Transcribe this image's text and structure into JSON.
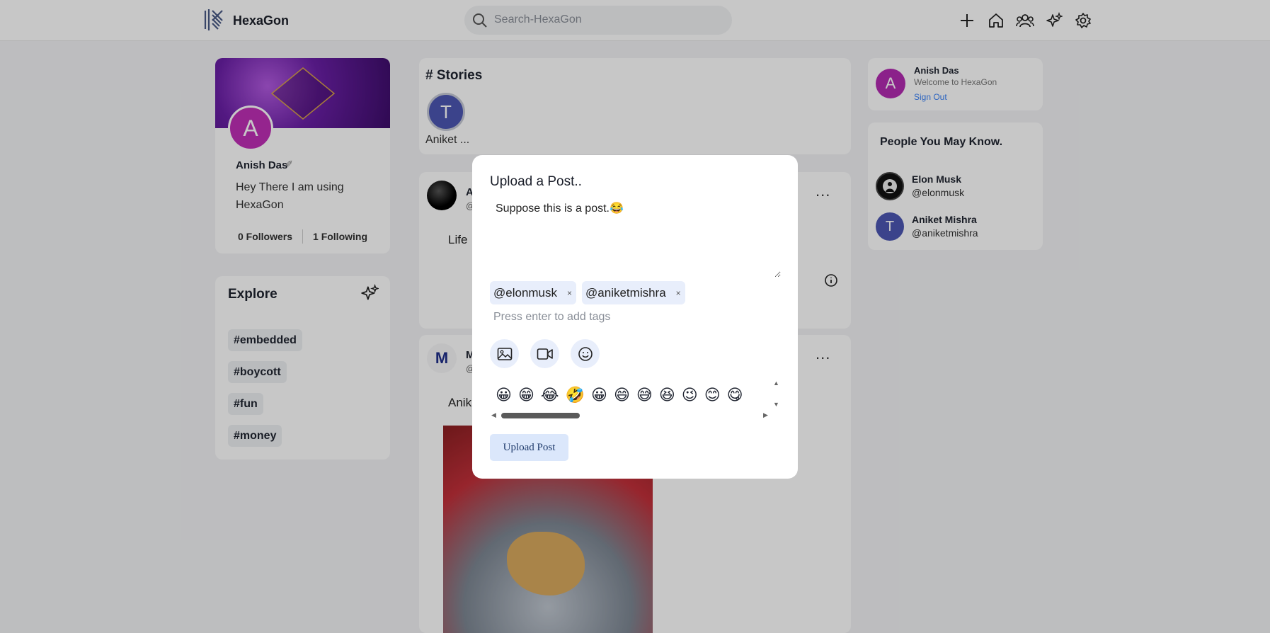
{
  "header": {
    "brand": "HexaGon",
    "search_placeholder": "Search-HexaGon",
    "icons": [
      "plus-icon",
      "home-icon",
      "people-icon",
      "sparkles-icon",
      "settings-icon"
    ]
  },
  "profile": {
    "avatar_letter": "A",
    "name": "Anish Das",
    "edit_glyph": "✐",
    "bio": "Hey There I am using HexaGon",
    "followers": "0 Followers",
    "following": "1 Following"
  },
  "explore": {
    "title": "Explore",
    "tags": [
      "#embedded",
      "#boycott",
      "#fun",
      "#money"
    ]
  },
  "stories": {
    "title": "# Stories",
    "items": [
      {
        "letter": "T",
        "name": "Aniket ..."
      }
    ]
  },
  "feed": {
    "post1": {
      "title": "A",
      "handle": "@",
      "text": "Life",
      "more": "..."
    },
    "post2": {
      "avatar_letter": "M",
      "title": "M",
      "handle": "@",
      "text": "Anik",
      "more": "..."
    }
  },
  "me": {
    "letter": "A",
    "name": "Anish Das",
    "welcome": "Welcome to HexaGon",
    "signout": "Sign Out"
  },
  "pymk": {
    "title": "People You May Know.",
    "people": [
      {
        "name": "Elon Musk",
        "handle": "@elonmusk",
        "letter": "",
        "color": "#111111"
      },
      {
        "name": "Aniket Mishra",
        "handle": "@aniketmishra",
        "letter": "T",
        "color": "#4c57b2"
      }
    ]
  },
  "modal": {
    "title": "Upload a Post..",
    "text": "Suppose this is a post.😂",
    "tags": [
      "@elonmusk",
      "@aniketmishra"
    ],
    "tag_remove": "×",
    "tag_placeholder": "Press enter to add tags",
    "emojis": [
      "😀",
      "😁",
      "😂",
      "🤣",
      "😀",
      "😄",
      "😅",
      "😆",
      "😉",
      "😊",
      "😋"
    ],
    "upload_label": "Upload Post"
  },
  "colors": {
    "accent": "#3b82f6",
    "chip": "#e8eefb",
    "overlay": "rgba(0,0,0,0.22)"
  }
}
